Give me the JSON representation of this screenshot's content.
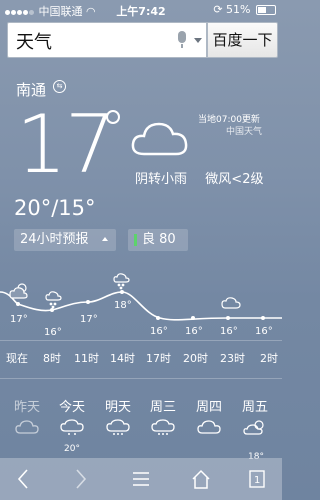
{
  "status": {
    "carrier": "中国联通",
    "time": "上午7:42",
    "battery": "51%"
  },
  "search": {
    "query": "天气",
    "button": "百度一下"
  },
  "weather": {
    "city": "南通",
    "temp": "17",
    "update": "当地07:00更新",
    "source": "中国天气",
    "condition": "阴转小雨",
    "wind": "微风<2级",
    "range": "20°/15°",
    "forecast_label": "24小时预报",
    "aqi_label": "良 80"
  },
  "hourly": {
    "labels": [
      "现在",
      "8时",
      "11时",
      "14时",
      "17时",
      "20时",
      "23时",
      "2时"
    ],
    "temps": [
      "17°",
      "16°",
      "17°",
      "18°",
      "16°",
      "16°",
      "16°",
      "16°"
    ]
  },
  "daily": {
    "days": [
      "昨天",
      "今天",
      "明天",
      "周三",
      "周四",
      "周五"
    ],
    "partial_temps": [
      "20°",
      "18°"
    ]
  },
  "colors": {
    "aqi_good": "#5dd36b"
  }
}
